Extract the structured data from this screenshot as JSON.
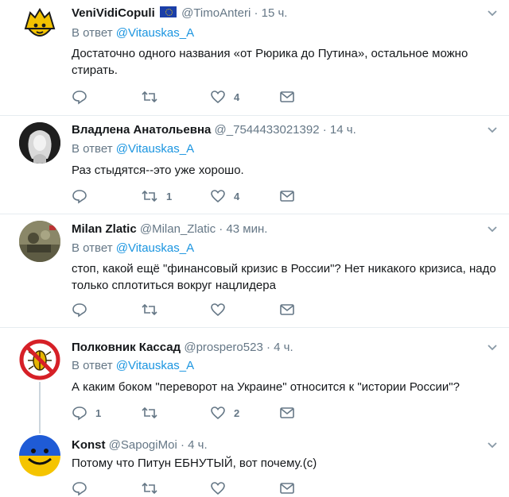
{
  "tweets": [
    {
      "name": "VeniVidiCopuli",
      "handle": "@TimoAnteri",
      "time": "· 15 ч.",
      "reply_prefix": "В ответ",
      "reply_to": "@Vitauskas_A",
      "text": "Достаточно одного названия «от Рюрика до Путина», остальное можно стирать.",
      "replies": "",
      "retweets": "",
      "likes": "4",
      "avatar": "lion-emblem"
    },
    {
      "name": "Владлена Анатольевна",
      "handle": "@_7544433021392",
      "time": "· 14 ч.",
      "reply_prefix": "В ответ",
      "reply_to": "@Vitauskas_A",
      "text": "Раз стыдятся--это уже хорошо.",
      "replies": "",
      "retweets": "1",
      "likes": "4",
      "avatar": "woman-portrait"
    },
    {
      "name": "Milan Zlatic",
      "handle": "@Milan_Zlatic",
      "time": "· 43 мин.",
      "reply_prefix": "В ответ",
      "reply_to": "@Vitauskas_A",
      "text": "стоп, какой ещё \"финансовый кризис в России\"? Нет никакого кризиса, надо только сплотиться вокруг нацлидера",
      "replies": "",
      "retweets": "",
      "likes": "",
      "avatar": "military-photo"
    },
    {
      "name": "Полковник Кассад",
      "handle": "@prospero523",
      "time": "· 4 ч.",
      "reply_prefix": "В ответ",
      "reply_to": "@Vitauskas_A",
      "text": "А каким боком \"переворот на Украине\" относится к \"истории России\"?",
      "replies": "1",
      "retweets": "",
      "likes": "2",
      "avatar": "no-beetle-sign"
    },
    {
      "name": "Konst",
      "handle": "@SapogiMoi",
      "time": "· 4 ч.",
      "text": "Потому что Питун ЕБНУТЫЙ, вот почему.(с)",
      "avatar": "smiley-flag"
    }
  ],
  "colors": {
    "accent": "#1b95e0",
    "muted": "#657786",
    "divider": "#e6ecf0"
  },
  "icons": [
    "reply-icon",
    "retweet-icon",
    "like-icon",
    "message-icon",
    "chevron-down-icon",
    "eu-flag-icon"
  ]
}
